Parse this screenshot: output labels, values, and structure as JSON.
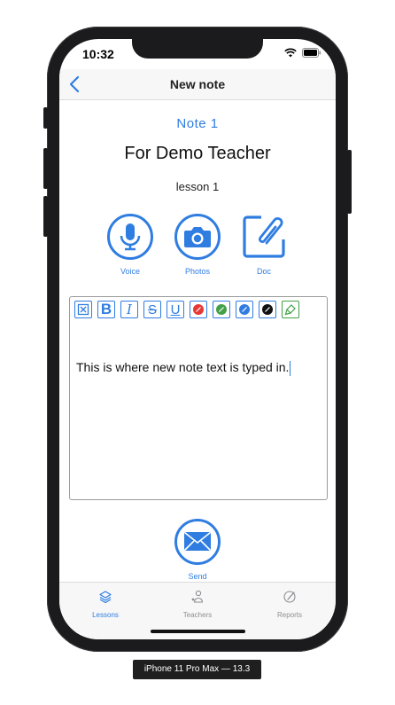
{
  "status_bar": {
    "time": "10:32"
  },
  "navbar": {
    "title": "New note"
  },
  "note": {
    "label": "Note  1",
    "teacher": "For Demo Teacher",
    "lesson": "lesson 1"
  },
  "actions": [
    {
      "label": "Voice",
      "icon": "microphone-icon"
    },
    {
      "label": "Photos",
      "icon": "camera-icon"
    },
    {
      "label": "Doc",
      "icon": "paperclip-document-icon"
    }
  ],
  "editor": {
    "text": "This is where new note text is typed in.",
    "toolbar": [
      {
        "icon": "clear-format-icon"
      },
      {
        "icon": "bold-icon",
        "glyph": "B"
      },
      {
        "icon": "italic-icon",
        "glyph": "I"
      },
      {
        "icon": "strikethrough-icon",
        "glyph": "S"
      },
      {
        "icon": "underline-icon",
        "glyph": "U"
      },
      {
        "icon": "color-red-icon",
        "color": "#e53935"
      },
      {
        "icon": "color-green-icon",
        "color": "#43a047"
      },
      {
        "icon": "color-blue-icon",
        "color": "#2f7de1"
      },
      {
        "icon": "color-black-icon",
        "color": "#111111"
      },
      {
        "icon": "highlighter-icon"
      }
    ]
  },
  "send": {
    "label": "Send"
  },
  "tabs": [
    {
      "label": "Lessons",
      "icon": "layers-icon",
      "active": true
    },
    {
      "label": "Teachers",
      "icon": "teacher-icon",
      "active": false
    },
    {
      "label": "Reports",
      "icon": "reports-icon",
      "active": false
    }
  ],
  "colors": {
    "accent": "#2f7de1",
    "inactive": "#8e8e93"
  },
  "device_label": "iPhone 11 Pro Max — 13.3"
}
